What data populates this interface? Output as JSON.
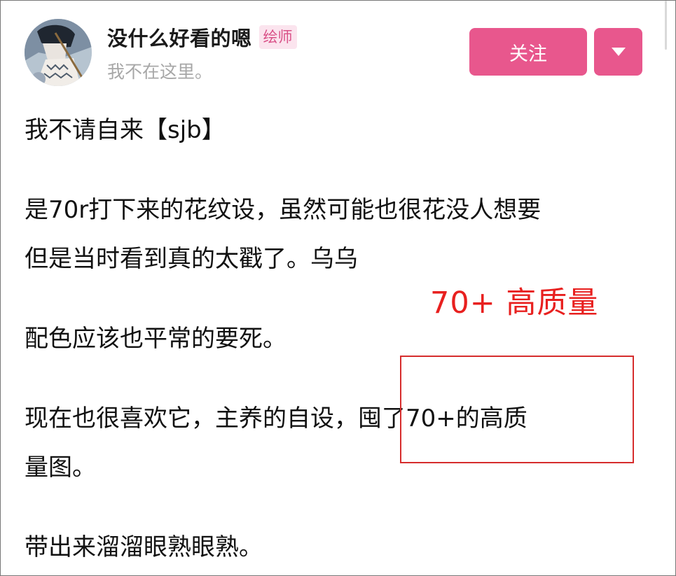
{
  "user": {
    "name": "没什么好看的嗯",
    "badge": "绘师",
    "bio": "我不在这里。"
  },
  "actions": {
    "follow_label": "关注",
    "more_icon": "caret-down-icon"
  },
  "post": {
    "lines": [
      "我不请自来【sjb】",
      "是70r打下来的花纹设，虽然可能也很花没人想要",
      "但是当时看到真的太戳了。乌乌",
      "配色应该也平常的要死。",
      "现在也很喜欢它，主养的自设，囤了70+的高质",
      "量图。",
      "带出来溜溜眼熟眼熟。"
    ]
  },
  "annotation": {
    "text": "70+ 高质量"
  },
  "colors": {
    "accent": "#e8578d",
    "badge_text": "#d94f86",
    "badge_bg": "#fbe4ee",
    "annotation": "#e8201f"
  }
}
